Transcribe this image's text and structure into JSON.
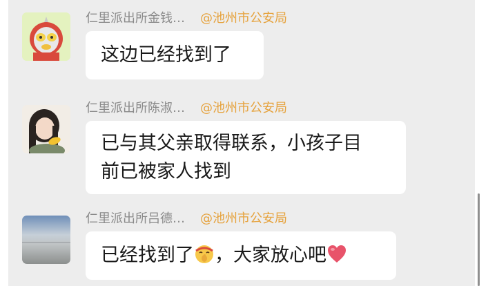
{
  "messages": [
    {
      "sender": "仁里派出所金钱…",
      "mention": "@池州市公安局",
      "text": "这边已经找到了"
    },
    {
      "sender": "仁里派出所陈淑…",
      "mention": "@池州市公安局",
      "text_line1": "已与其父亲取得联系，小孩子目",
      "text_line2": "前已被家人找到"
    },
    {
      "sender": "仁里派出所吕德…",
      "mention": "@池州市公安局",
      "text_before": "已经找到了",
      "text_after": "，大家放心吧",
      "emojis": [
        "shush-face-emoji",
        "red-heart-emoji"
      ]
    }
  ],
  "colors": {
    "chat_background": "#ededed",
    "bubble": "#ffffff",
    "sender_text": "#8a8a8a",
    "mention_text": "#e6a23c",
    "heart": "#e8536a"
  }
}
